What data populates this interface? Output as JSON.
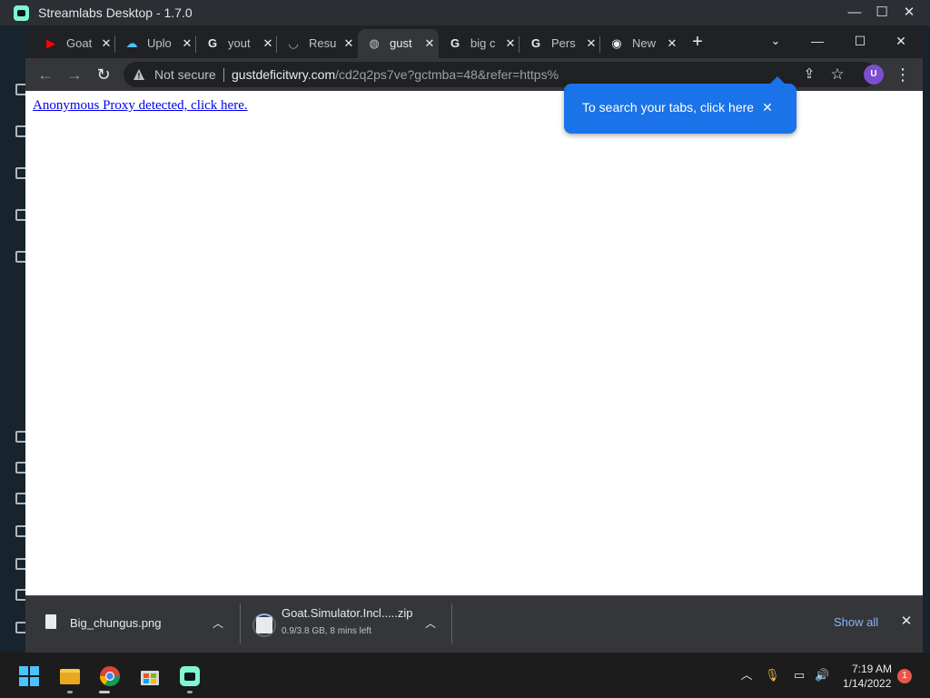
{
  "background_app": {
    "title": "Streamlabs Desktop - 1.7.0",
    "accent": "#80f5d2",
    "window_controls": [
      "minimize-icon",
      "maximize-icon",
      "close-icon"
    ]
  },
  "browser": {
    "tabs": [
      {
        "title": "Goat",
        "icon": "youtube-icon",
        "icon_glyph": "▶",
        "icon_color": "#ff0000",
        "active": false
      },
      {
        "title": "Uplo",
        "icon": "cloud-upload-icon",
        "icon_glyph": "☁",
        "icon_color": "#4cc2ff",
        "active": false
      },
      {
        "title": "yout",
        "icon": "google-icon",
        "icon_glyph": "G",
        "icon_color": "#e8eaed",
        "active": false
      },
      {
        "title": "Resu",
        "icon": "loading-spinner-icon",
        "icon_glyph": "◡",
        "icon_color": "#8ab4f8",
        "active": false
      },
      {
        "title": "gust",
        "icon": "globe-icon",
        "icon_glyph": "◍",
        "icon_color": "#bdc1c6",
        "active": true
      },
      {
        "title": "big c",
        "icon": "google-icon",
        "icon_glyph": "G",
        "icon_color": "#e8eaed",
        "active": false
      },
      {
        "title": "Pers",
        "icon": "google-icon",
        "icon_glyph": "G",
        "icon_color": "#e8eaed",
        "active": false
      },
      {
        "title": "New",
        "icon": "chrome-icon",
        "icon_glyph": "◉",
        "icon_color": "#e8eaed",
        "active": false
      }
    ],
    "tab_close_glyph": "✕",
    "new_tab_glyph": "+",
    "security_label": "Not secure",
    "url_host": "gustdeficitwry.com",
    "url_path": "/cd2q2ps7ve?gctmba=48&refer=https%",
    "tab_search_bubble": {
      "text": "To search your tabs, click here",
      "close": "✕"
    },
    "avatar_letter": "U",
    "page_link": "Anonymous Proxy detected, click here.",
    "downloads": [
      {
        "name": "Big_chungus.png",
        "status": ""
      },
      {
        "name": "Goat.Simulator.Incl.....zip",
        "status": "0.9/3.8 GB, 8 mins left"
      }
    ],
    "show_all": "Show all",
    "accent": "#1a73e8"
  },
  "taskbar": {
    "time": "7:19 AM",
    "date": "1/14/2022",
    "notification_count": "1"
  }
}
